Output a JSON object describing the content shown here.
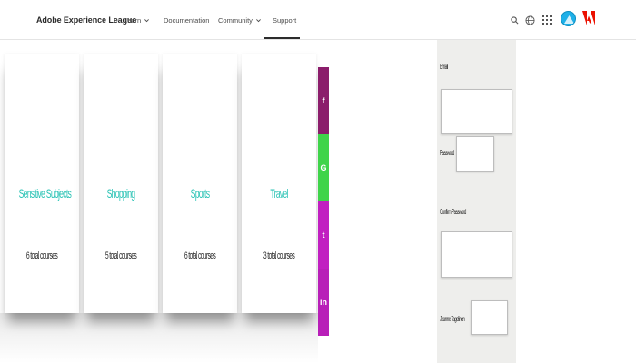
{
  "nav": {
    "brand": "Adobe Experience League",
    "items": [
      {
        "label": "Learn",
        "has_dropdown": true
      },
      {
        "label": "Documentation",
        "has_dropdown": false
      },
      {
        "label": "Community",
        "has_dropdown": true
      },
      {
        "label": "Support",
        "has_dropdown": false,
        "active": true
      }
    ],
    "icons": [
      "search-icon",
      "globe-icon",
      "apps-grid-icon"
    ],
    "avatar_color": "#1fb0e8",
    "logo_color": "#eb1000"
  },
  "courses": [
    {
      "title": "Sensitive Subjects",
      "subtitle": "6 total courses"
    },
    {
      "title": "Shopping",
      "subtitle": "5 total courses"
    },
    {
      "title": "Sports",
      "subtitle": "6 total courses"
    },
    {
      "title": "Travel",
      "subtitle": "3 total courses"
    }
  ],
  "social": [
    {
      "name": "facebook",
      "glyph": "f",
      "color": "#8b1d6b"
    },
    {
      "name": "google-plus",
      "glyph": "G",
      "color": "#3fd44a"
    },
    {
      "name": "twitter",
      "glyph": "t",
      "color": "#c11fc1"
    },
    {
      "name": "linkedin",
      "glyph": "in",
      "color": "#b81fb8"
    }
  ],
  "form": {
    "email_label": "Email",
    "password_label": "Password",
    "confirm_password_label": "Confirm Password",
    "last_label": "Jeanne Tagelinen",
    "email_value": "",
    "password_value": "",
    "confirm_value": "",
    "last_value": ""
  }
}
